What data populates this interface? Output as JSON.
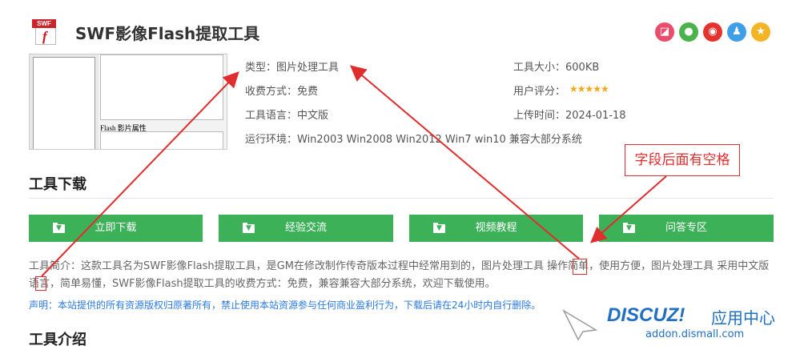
{
  "header": {
    "title": "SWF影像Flash提取工具",
    "icon_band": "SWF",
    "icon_letter": "f"
  },
  "share_icons": [
    {
      "name": "taobao-icon",
      "glyph": "◪",
      "color": "#ea4c6b"
    },
    {
      "name": "wechat-icon",
      "glyph": "●",
      "color": "#4bb34b"
    },
    {
      "name": "weibo-icon",
      "glyph": "◉",
      "color": "#e6322e"
    },
    {
      "name": "qq-icon",
      "glyph": "♟",
      "color": "#3e9fe6"
    },
    {
      "name": "qzone-icon",
      "glyph": "★",
      "color": "#f3b425"
    }
  ],
  "thumbnail": {
    "caption": "Flash 影片属性"
  },
  "info": {
    "type": "类型：图片处理工具",
    "size": "工具大小：600KB",
    "fee": "收费方式：免费",
    "rating_label": "用户评分：",
    "rating_value": 4.5,
    "rating_stars": "★★★★★",
    "language": "工具语言：中文版",
    "upload": "上传时间：2024-01-18",
    "env": "运行环境：Win2003 Win2008 Win2012 Win7 win10 兼容大部分系统"
  },
  "download_section": {
    "title": "工具下载",
    "buttons": [
      {
        "label": "立即下载"
      },
      {
        "label": "经验交流"
      },
      {
        "label": "视频教程"
      },
      {
        "label": "问答专区"
      }
    ]
  },
  "intro": {
    "text": "工具简介：这款工具名为SWF影像Flash提取工具，是GM在修改制作传奇版本过程中经常用到的，图片处理工具 操作简单，使用方便，图片处理工具 采用中文版语言，简单易懂，SWF影像Flash提取工具的收费方式：免费，兼容兼容大部分系统，欢迎下载使用。",
    "notice": "声明：本站提供的所有资源版权归原著所有，禁止使用本站资源参与任何商业盈利行为，下载后请在24小时内自行删除。"
  },
  "intro_section": {
    "title": "工具介绍"
  },
  "annotation": {
    "callout": "字段后面有空格",
    "color": "#e02d2d"
  },
  "watermark": {
    "logo": "DISCUZ!",
    "zh": "应用中心",
    "url": "addon.dismall.com"
  }
}
